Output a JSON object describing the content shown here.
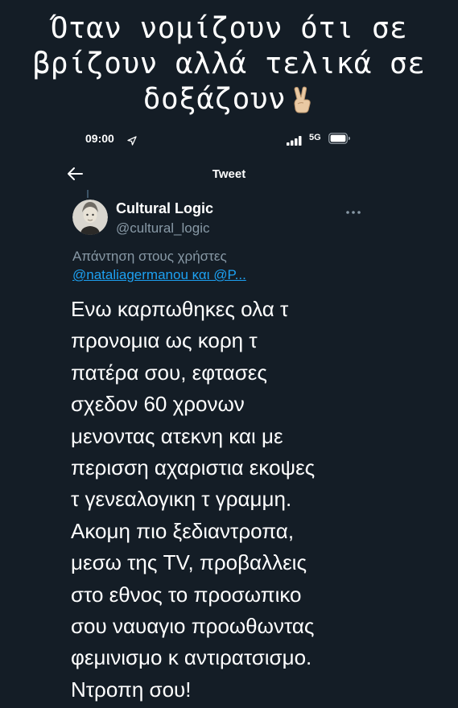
{
  "caption": {
    "lines": [
      "Όταν νομίζουν ότι σε",
      "βρίζουν αλλά τελικά σε",
      "δοξάζουν"
    ],
    "emoji": "victory-hand-icon"
  },
  "status_bar": {
    "time": "09:00",
    "network": "5G",
    "icons": [
      "location-arrow-icon",
      "signal-bars-icon",
      "battery-icon"
    ]
  },
  "nav": {
    "title": "Tweet",
    "back_icon": "back-arrow-icon"
  },
  "tweet": {
    "author_name": "Cultural Logic",
    "author_handle": "@cultural_logic",
    "reply_label": "Απάντηση στους χρήστες",
    "reply_mentions": "@nataliagermanou και @P...",
    "more_icon": "more-dots-icon",
    "text_lines": [
      "Ενω καρπωθηκες ολα τ",
      "προνομια ως κορη τ",
      "πατέρα σου, εφτασες",
      "σχεδον 60 χρονων",
      "μενοντας ατεκνη και με",
      "περισση αχαριστια εκοψες",
      "τ γενεαλογικη τ γραμμη.",
      "Ακομη πιο ξεδιαντροπα,",
      "μεσω της TV, προβαλλεις",
      "στο εθνος το προσωπικο",
      "σου ναυαγιο προωθωντας",
      "φεμινισμο κ αντιρατσισμο.",
      "Ντροπη σου!"
    ]
  },
  "colors": {
    "background": "#141d26",
    "text": "#ffffff",
    "secondary": "#8899a6",
    "link": "#1da1f2"
  }
}
